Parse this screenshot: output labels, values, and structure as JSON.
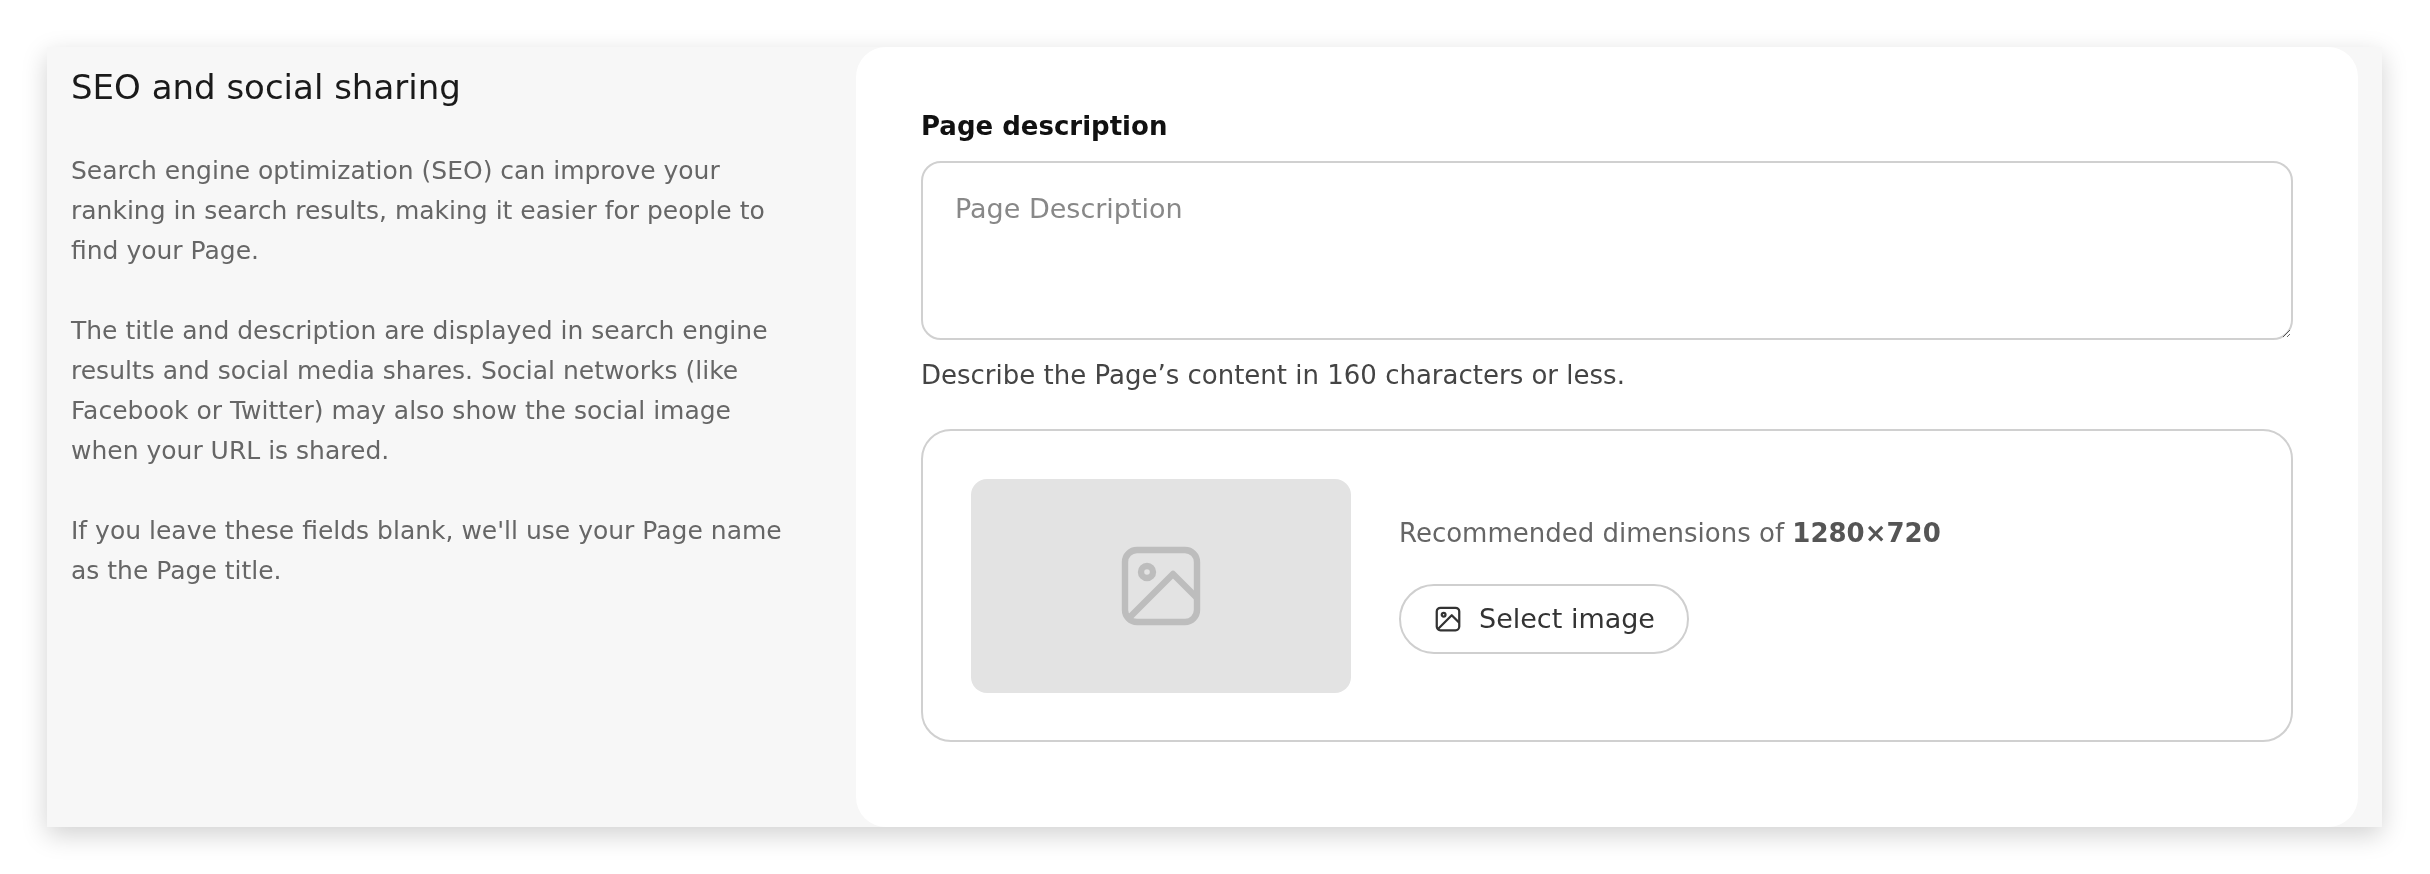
{
  "section": {
    "title": "SEO and social sharing",
    "paragraphs": [
      "Search engine optimization (SEO) can improve your ranking in search results, making it easier for people to find your Page.",
      "The title and description are displayed in search engine results and social media shares. Social networks (like Facebook or Twitter) may also show the social image when your URL is shared.",
      "If you leave these fields blank, we'll use your Page name as the Page title."
    ]
  },
  "description_field": {
    "label": "Page description",
    "placeholder": "Page Description",
    "help": "Describe the Page’s content in 160 characters or less."
  },
  "social_image": {
    "hint": "Recommended dimensions of **1280×720**",
    "button": "Select image"
  }
}
